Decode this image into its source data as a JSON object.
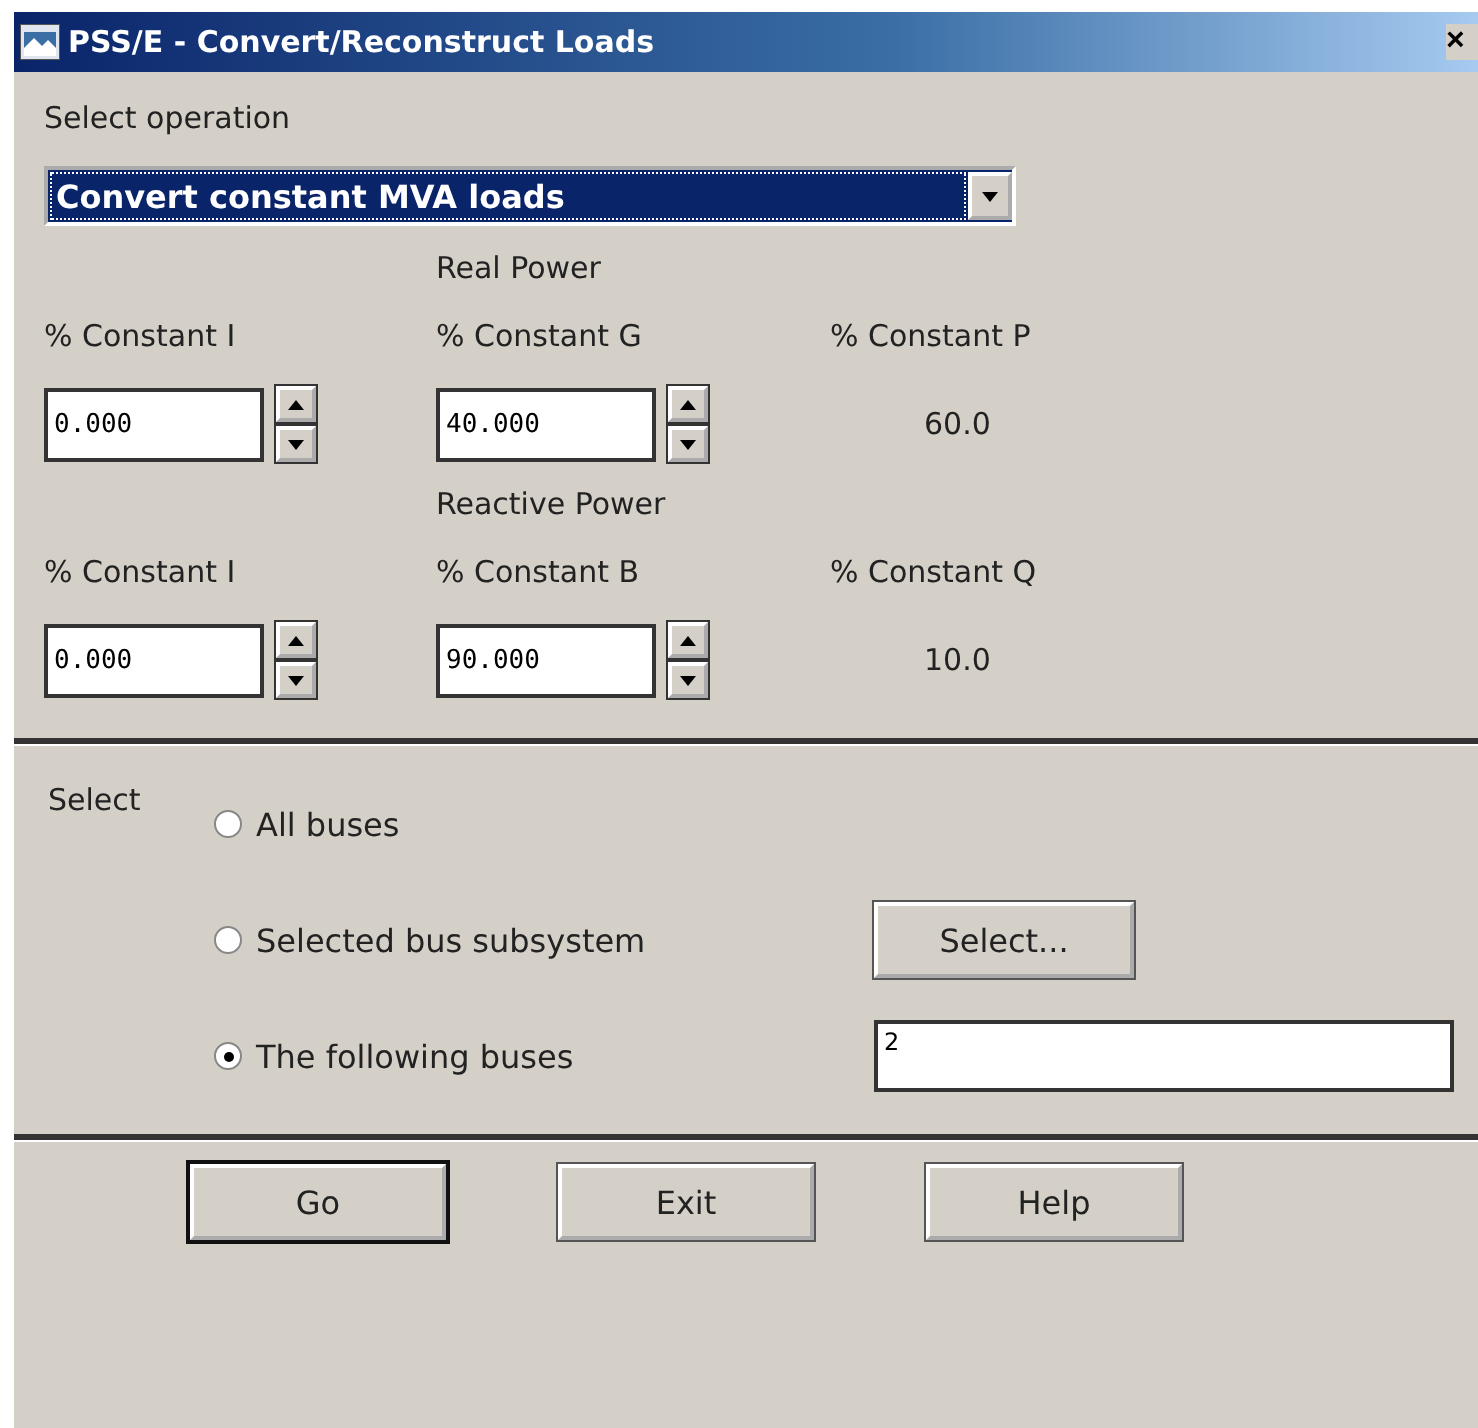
{
  "window": {
    "title": "PSS/E - Convert/Reconstruct Loads",
    "close": "×"
  },
  "operation": {
    "label": "Select operation",
    "value": "Convert constant MVA loads"
  },
  "sections": [
    {
      "heading": "Real Power",
      "columns": [
        "% Constant I",
        "% Constant G",
        "% Constant P"
      ],
      "fields": [
        "0.000",
        "40.000"
      ],
      "result": "60.0"
    },
    {
      "heading": "Reactive Power",
      "columns": [
        "% Constant I",
        "% Constant B",
        "% Constant Q"
      ],
      "fields": [
        "0.000",
        "90.000"
      ],
      "result": "10.0"
    }
  ],
  "select": {
    "label": "Select",
    "options": [
      {
        "label": "All buses",
        "selected": false
      },
      {
        "label": "Selected bus subsystem",
        "selected": false
      },
      {
        "label": "The following buses",
        "selected": true
      }
    ],
    "select_button": "Select...",
    "buses_value": "2"
  },
  "buttons": [
    {
      "label": "Go",
      "default": true
    },
    {
      "label": "Exit",
      "default": false
    },
    {
      "label": "Help",
      "default": false
    }
  ]
}
